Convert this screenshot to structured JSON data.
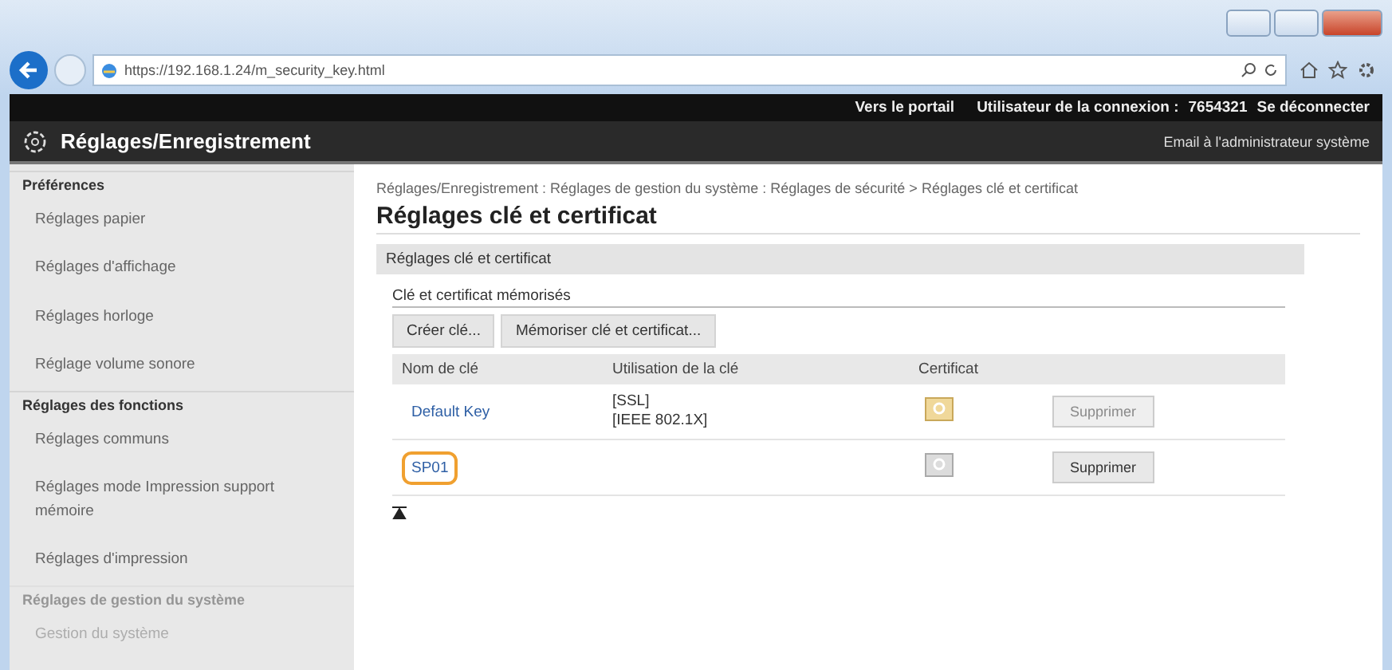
{
  "browser": {
    "address": "https://192.168.1.24/m_security_key.html"
  },
  "top_bar": {
    "portal_link": "Vers le portail",
    "user_label": "Utilisateur de la connexion :",
    "user_id": "7654321",
    "logout_link": "Se déconnecter"
  },
  "header": {
    "title": "Réglages/Enregistrement",
    "email_link": "Email à l'administrateur système"
  },
  "sidebar": {
    "items": [
      {
        "kind": "heading",
        "label": "Préférences"
      },
      {
        "kind": "item",
        "label": "Réglages papier"
      },
      {
        "kind": "item",
        "label": "Réglages d'affichage"
      },
      {
        "kind": "item",
        "label": "Réglages horloge"
      },
      {
        "kind": "item",
        "label": "Réglage volume sonore"
      },
      {
        "kind": "heading",
        "label": "Réglages des fonctions"
      },
      {
        "kind": "item",
        "label": "Réglages communs"
      },
      {
        "kind": "item",
        "label": "Réglages mode Impression support mémoire"
      },
      {
        "kind": "item",
        "label": "Réglages d'impression"
      },
      {
        "kind": "heading",
        "label": "Réglages de gestion du système"
      },
      {
        "kind": "item",
        "label": "Gestion du système"
      }
    ]
  },
  "breadcrumb": "Réglages/Enregistrement : Réglages de gestion du système : Réglages de sécurité > Réglages clé et certificat",
  "page_title": "Réglages clé et certificat",
  "section_title": "Réglages clé et certificat",
  "subsection_title": "Clé et certificat mémorisés",
  "buttons": [
    "Créer clé...",
    "Mémoriser clé et certificat..."
  ],
  "table": {
    "columns": [
      "Nom de clé",
      "Utilisation de la clé",
      "Certificat"
    ],
    "rows": [
      {
        "name": "Default Key",
        "usage": [
          "[SSL]",
          "[IEEE 802.1X]"
        ],
        "certificate_valid": true,
        "delete": "Supprimer",
        "delete_disabled": true,
        "highlighted": false
      },
      {
        "name": "SP01",
        "usage": [],
        "certificate_valid": false,
        "delete": "Supprimer",
        "delete_disabled": false,
        "highlighted": true
      }
    ]
  }
}
